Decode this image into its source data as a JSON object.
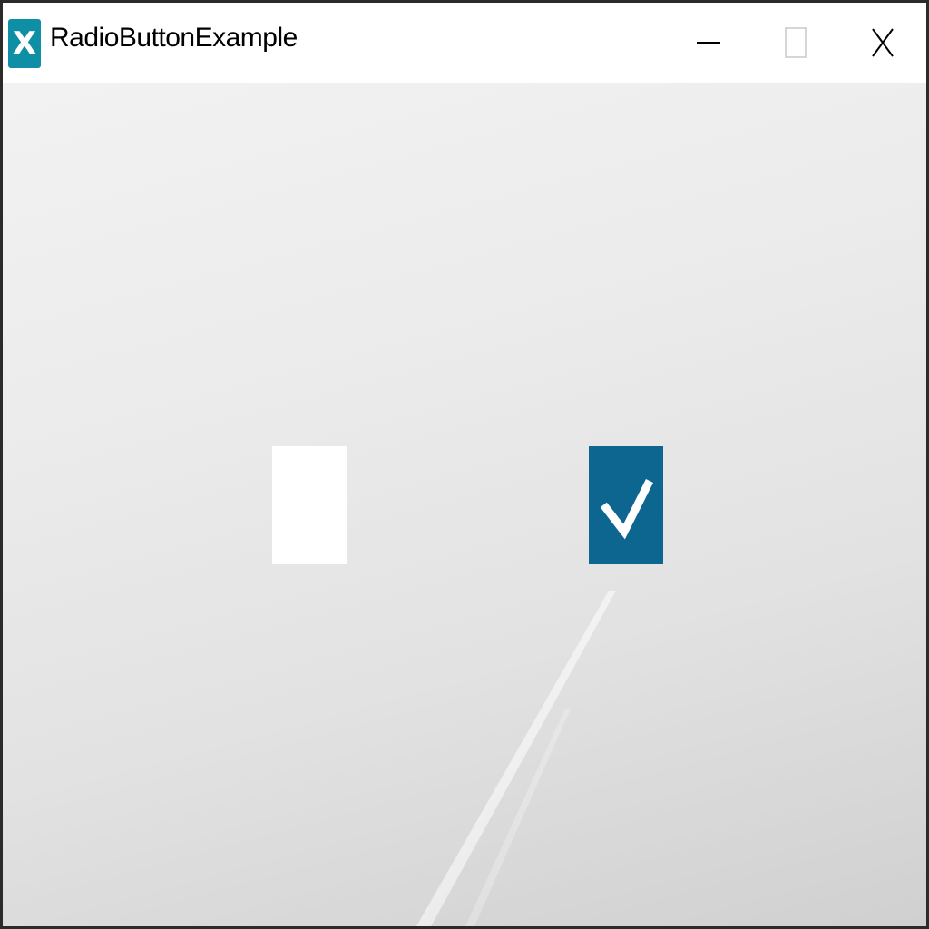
{
  "window": {
    "title": "RadioButtonExample",
    "app_icon_letter": "X",
    "app_icon_color": "#0f8fa6"
  },
  "caption_buttons": {
    "minimize_icon": "minimize-icon",
    "maximize_icon": "maximize-icon",
    "close_icon": "close-icon"
  },
  "radio_buttons": [
    {
      "checked": false,
      "color": "#ffffff"
    },
    {
      "checked": true,
      "color": "#0d6690",
      "check_mark_color": "#ffffff"
    }
  ]
}
